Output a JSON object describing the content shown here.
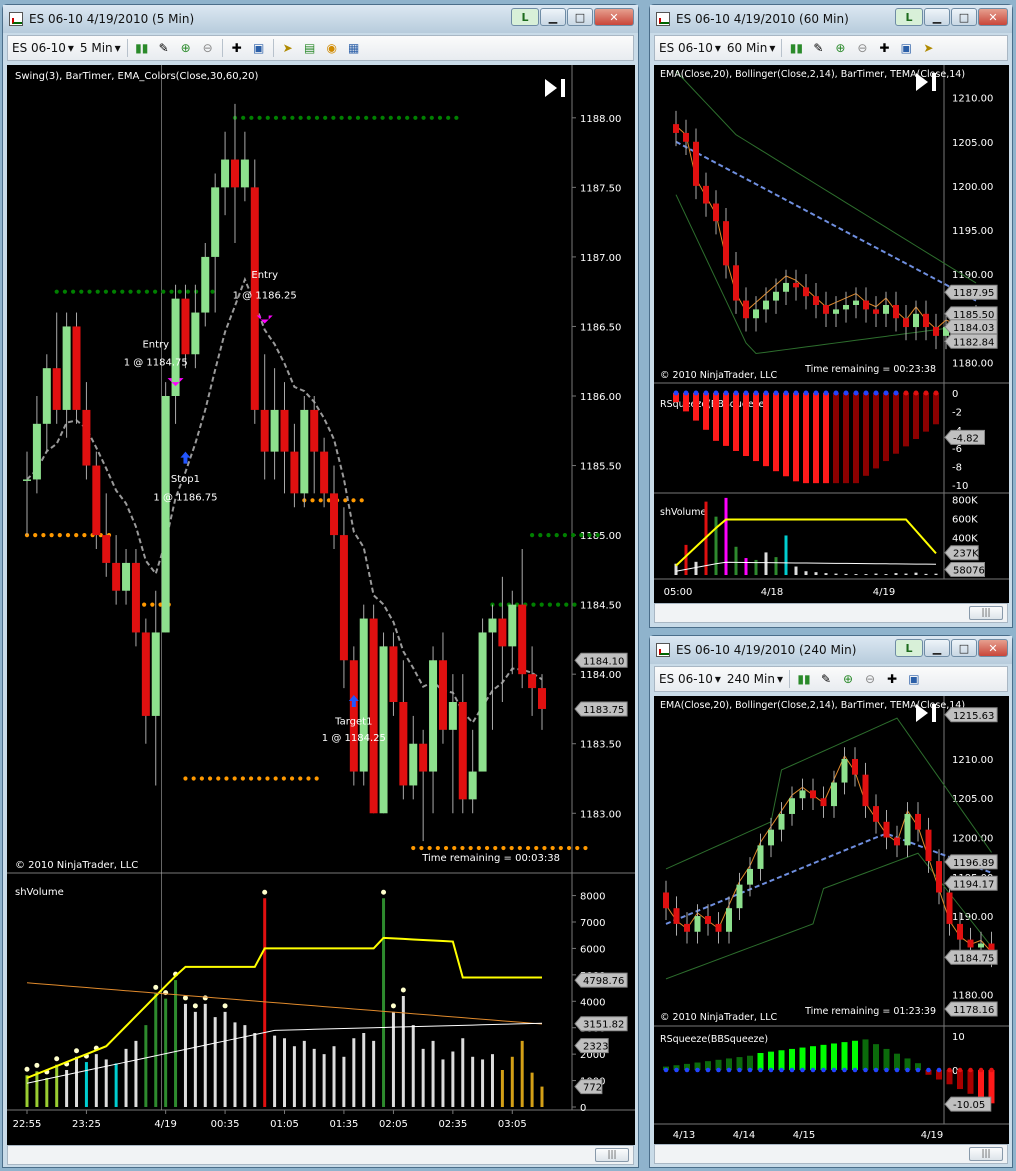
{
  "colors": {
    "up": "#8de08d",
    "down": "#e01010",
    "green_dot": "#008000",
    "orange_dot": "#ff9900",
    "ema": "#9a9a9a",
    "volume_yellow": "#ffff00",
    "axis_label_bg": "#c0c0c0"
  },
  "window_5min": {
    "title": "ES 06-10  4/19/2010 (5 Min)",
    "toolbar": {
      "instrument": "ES 06-10",
      "interval": "5 Min"
    },
    "price_panel": {
      "indicators_label": "Swing(3), BarTimer, EMA_Colors(Close,30,60,20)",
      "copyright": "© 2010 NinjaTrader, LLC",
      "time_remaining": "Time remaining = 00:03:38",
      "y_ticks": [
        "1188.00",
        "1187.50",
        "1187.00",
        "1186.50",
        "1186.00",
        "1185.50",
        "1185.00",
        "1184.50",
        "1184.00",
        "1183.50",
        "1183.00"
      ],
      "price_tags": [
        "1184.10",
        "1183.75"
      ],
      "annotations": [
        {
          "line1": "Entry",
          "line2": "1 @ 1186.25"
        },
        {
          "line1": "Entry",
          "line2": "1 @ 1184.75"
        },
        {
          "line1": "Stop1",
          "line2": "1 @ 1186.75"
        },
        {
          "line1": "Target1",
          "line2": "1 @ 1184.25"
        }
      ]
    },
    "volume_panel": {
      "label": "shVolume",
      "y_ticks": [
        "8000",
        "7000",
        "6000",
        "5000",
        "4000",
        "3000",
        "2000",
        "1000",
        "0"
      ],
      "tags": [
        "4798.76",
        "3151.82",
        "2323",
        "772"
      ]
    },
    "x_ticks": [
      "22:55",
      "23:25",
      "4/19",
      "00:35",
      "01:05",
      "01:35",
      "02:05",
      "02:35",
      "03:05"
    ]
  },
  "window_60min": {
    "title": "ES 06-10  4/19/2010 (60 Min)",
    "toolbar": {
      "instrument": "ES 06-10",
      "interval": "60 Min"
    },
    "price_panel": {
      "indicators_label": "EMA(Close,20), Bollinger(Close,2,14), BarTimer, TEMA(Close,14)",
      "copyright": "© 2010 NinjaTrader, LLC",
      "time_remaining": "Time remaining = 00:23:38",
      "y_ticks": [
        "1210.00",
        "1205.00",
        "1200.00",
        "1195.00",
        "1190.00",
        "1185.00",
        "1180.00"
      ],
      "tags": [
        "1187.95",
        "1185.50",
        "1184.03",
        "1182.84"
      ]
    },
    "squeeze_panel": {
      "label": "RSqueeze(BBSqueeze)",
      "y_ticks": [
        "0",
        "-2",
        "-4",
        "-6",
        "-8",
        "-10"
      ],
      "tags": [
        "-4.82"
      ]
    },
    "volume_panel": {
      "label": "shVolume",
      "y_ticks": [
        "800K",
        "600K",
        "400K",
        "200K"
      ],
      "tags": [
        "237K",
        "58076"
      ]
    },
    "x_ticks": [
      "05:00",
      "4/18",
      "4/19"
    ]
  },
  "window_240min": {
    "title": "ES 06-10  4/19/2010 (240 Min)",
    "toolbar": {
      "instrument": "ES 06-10",
      "interval": "240 Min"
    },
    "price_panel": {
      "indicators_label": "EMA(Close,20), Bollinger(Close,2,14), BarTimer, TEMA(Close,14)",
      "copyright": "© 2010 NinjaTrader, LLC",
      "time_remaining": "Time remaining = 01:23:39",
      "y_ticks": [
        "1210.00",
        "1205.00",
        "1200.00",
        "1195.00",
        "1190.00",
        "1185.00",
        "1180.00"
      ],
      "tags": [
        "1215.63",
        "1196.89",
        "1194.17",
        "1184.75",
        "1178.16"
      ]
    },
    "squeeze_panel": {
      "label": "RSqueeze(BBSqueeze)",
      "y_ticks": [
        "10",
        "0"
      ],
      "tags": [
        "-10.05"
      ]
    },
    "x_ticks": [
      "4/13",
      "4/14",
      "4/15",
      "4/19"
    ]
  },
  "chart_data": [
    {
      "type": "candlestick",
      "title": "ES 06-10 4/19/2010 (5 Min)",
      "ylim": [
        1182.7,
        1188.2
      ],
      "bars": [
        [
          1185.4,
          1185.6,
          1185.0,
          1185.4
        ],
        [
          1185.4,
          1186.0,
          1185.3,
          1185.8
        ],
        [
          1185.8,
          1186.3,
          1185.6,
          1186.2
        ],
        [
          1186.2,
          1186.6,
          1185.8,
          1185.9
        ],
        [
          1185.9,
          1186.6,
          1185.7,
          1186.5
        ],
        [
          1186.5,
          1186.6,
          1185.8,
          1185.9
        ],
        [
          1185.9,
          1186.1,
          1185.4,
          1185.5
        ],
        [
          1185.5,
          1185.6,
          1184.9,
          1185.0
        ],
        [
          1185.0,
          1185.3,
          1184.7,
          1184.8
        ],
        [
          1184.8,
          1185.0,
          1184.5,
          1184.6
        ],
        [
          1184.6,
          1184.9,
          1184.5,
          1184.8
        ],
        [
          1184.8,
          1184.9,
          1184.2,
          1184.3
        ],
        [
          1184.3,
          1184.4,
          1183.5,
          1183.7
        ],
        [
          1183.7,
          1184.6,
          1183.2,
          1184.3
        ],
        [
          1184.3,
          1186.1,
          1184.3,
          1186.0
        ],
        [
          1186.0,
          1186.8,
          1185.8,
          1186.7
        ],
        [
          1186.7,
          1186.8,
          1186.2,
          1186.3
        ],
        [
          1186.3,
          1186.8,
          1186.2,
          1186.6
        ],
        [
          1186.6,
          1187.1,
          1186.5,
          1187.0
        ],
        [
          1187.0,
          1187.6,
          1186.6,
          1187.5
        ],
        [
          1187.5,
          1187.9,
          1187.3,
          1187.7
        ],
        [
          1187.7,
          1188.1,
          1187.1,
          1187.5
        ],
        [
          1187.5,
          1187.9,
          1187.4,
          1187.7
        ],
        [
          1187.5,
          1187.7,
          1185.8,
          1185.9
        ],
        [
          1185.9,
          1186.3,
          1185.4,
          1185.6
        ],
        [
          1185.6,
          1186.2,
          1185.4,
          1185.9
        ],
        [
          1185.9,
          1186.1,
          1185.3,
          1185.6
        ],
        [
          1185.6,
          1185.8,
          1185.2,
          1185.3
        ],
        [
          1185.3,
          1186.0,
          1185.2,
          1185.9
        ],
        [
          1185.9,
          1186.0,
          1185.3,
          1185.6
        ],
        [
          1185.6,
          1185.7,
          1185.2,
          1185.3
        ],
        [
          1185.3,
          1185.5,
          1184.9,
          1185.0
        ],
        [
          1185.0,
          1185.2,
          1183.9,
          1184.1
        ],
        [
          1184.1,
          1184.2,
          1183.2,
          1183.3
        ],
        [
          1183.3,
          1184.5,
          1183.2,
          1184.4
        ],
        [
          1184.4,
          1184.5,
          1183.0,
          1183.0
        ],
        [
          1183.0,
          1184.3,
          1183.0,
          1184.2
        ],
        [
          1184.2,
          1184.3,
          1183.7,
          1183.8
        ],
        [
          1183.8,
          1184.1,
          1183.1,
          1183.2
        ],
        [
          1183.2,
          1183.7,
          1183.1,
          1183.5
        ],
        [
          1183.5,
          1183.6,
          1182.8,
          1183.3
        ],
        [
          1183.3,
          1184.2,
          1183.0,
          1184.1
        ],
        [
          1184.1,
          1184.3,
          1183.5,
          1183.6
        ],
        [
          1183.6,
          1184.0,
          1183.0,
          1183.8
        ],
        [
          1183.8,
          1184.0,
          1183.0,
          1183.1
        ],
        [
          1183.1,
          1183.6,
          1183.0,
          1183.3
        ],
        [
          1183.3,
          1184.4,
          1183.3,
          1184.3
        ],
        [
          1184.3,
          1184.5,
          1183.6,
          1184.4
        ],
        [
          1184.4,
          1184.7,
          1183.8,
          1184.2
        ],
        [
          1184.2,
          1184.6,
          1184.0,
          1184.5
        ],
        [
          1184.5,
          1184.9,
          1183.9,
          1184.0
        ],
        [
          1184.0,
          1184.2,
          1183.7,
          1183.9
        ],
        [
          1183.9,
          1184.0,
          1183.6,
          1183.75
        ]
      ],
      "bar_format": "open, high, low, close",
      "volume": [
        1200,
        1350,
        1100,
        1600,
        1400,
        1900,
        1700,
        2000,
        1800,
        1650,
        2200,
        2500,
        3100,
        4300,
        4100,
        4800,
        3900,
        3600,
        3900,
        3400,
        3600,
        3200,
        3100,
        2800,
        7900,
        2700,
        2600,
        2300,
        2500,
        2200,
        2000,
        2300,
        1900,
        2600,
        2800,
        2500,
        7900,
        3600,
        4200,
        3100,
        2200,
        2500,
        1800,
        2100,
        2600,
        1900,
        1800,
        2000,
        1400,
        1900,
        2500,
        1300,
        772
      ],
      "swing_high_levels": [
        1188.0,
        1186.75,
        1185.0,
        1184.5
      ],
      "swing_low_levels": [
        1185.0,
        1184.5,
        1183.25,
        1182.75
      ]
    }
  ]
}
